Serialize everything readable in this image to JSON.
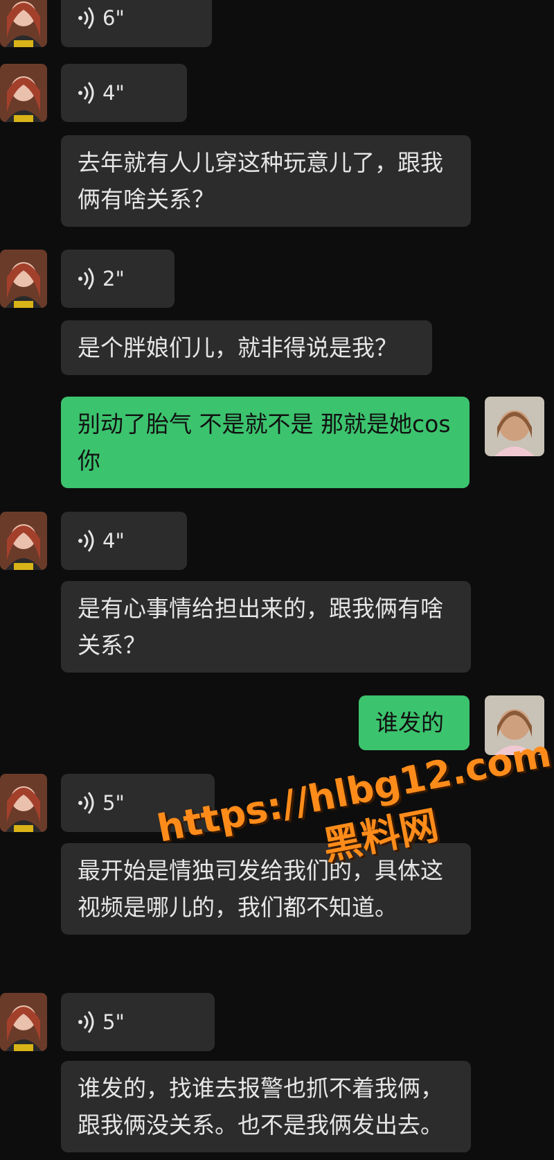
{
  "colors": {
    "background": "#0d0d0d",
    "incoming_bubble": "#2c2c2c",
    "outgoing_bubble": "#3cc36e",
    "watermark": "#ff8c1a"
  },
  "messages": {
    "m1_voice": "6\"",
    "m2_voice": "4\"",
    "m2_text": "去年就有人儿穿这种玩意儿了，跟我俩有啥关系？",
    "m3_voice": "2\"",
    "m3_text": "是个胖娘们儿，就非得说是我？",
    "m4_mine": "别动了胎气 不是就不是 那就是她cos 你",
    "m5_voice": "4\"",
    "m5_text": "是有心事情给担出来的，跟我俩有啥关系？",
    "m6_mine": "谁发的",
    "m7_voice": "5\"",
    "m7_text": "最开始是情独司发给我们的，具体这视频是哪儿的，我们都不知道。",
    "m8_voice": "5\"",
    "m8_text": "谁发的，找谁去报警也抓不着我俩，跟我俩没关系。也不是我俩发出去。"
  },
  "watermark": {
    "url": "https://hlbg12.com",
    "label": "黑料网"
  },
  "icons": {
    "voice": "voice-wave-icon",
    "contact_avatar": "contact-avatar",
    "self_avatar": "self-avatar"
  }
}
